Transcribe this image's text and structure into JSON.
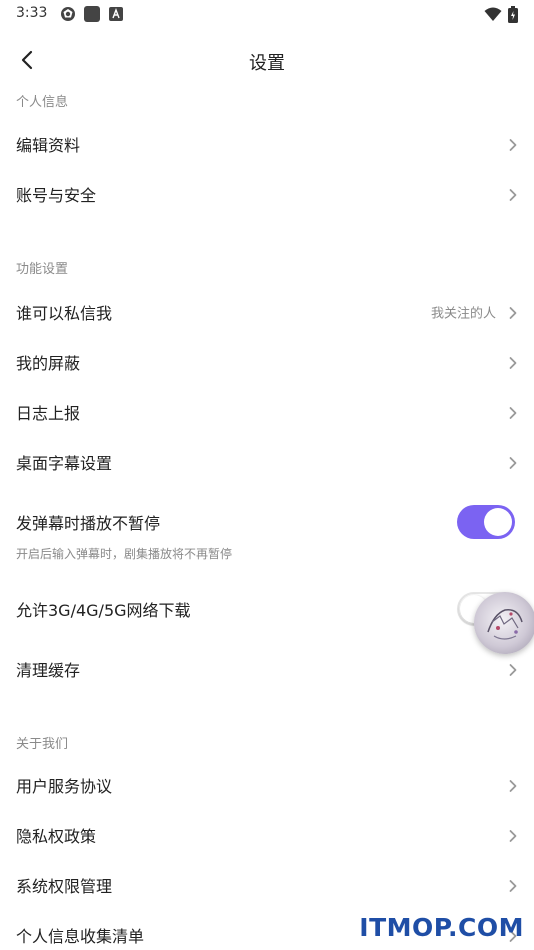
{
  "status_bar": {
    "time": "3:33",
    "icons": [
      "aperture-icon",
      "square-app-icon",
      "a-app-icon",
      "wifi-icon",
      "battery-icon"
    ]
  },
  "header": {
    "title": "设置",
    "back_icon": "chevron-left-icon"
  },
  "sections": {
    "personal": {
      "title": "个人信息",
      "items": [
        {
          "label": "编辑资料"
        },
        {
          "label": "账号与安全"
        }
      ]
    },
    "features": {
      "title": "功能设置",
      "items": [
        {
          "label": "谁可以私信我",
          "value": "我关注的人"
        },
        {
          "label": "我的屏蔽"
        },
        {
          "label": "日志上报"
        },
        {
          "label": "桌面字幕设置"
        }
      ],
      "danmaku_toggle": {
        "label": "发弹幕时播放不暂停",
        "description": "开启后输入弹幕时，剧集播放将不再暂停",
        "on": true
      },
      "network_toggle": {
        "label": "允许3G/4G/5G网络下载",
        "on": false
      },
      "clear_cache": {
        "label": "清理缓存"
      }
    },
    "about": {
      "title": "关于我们",
      "items": [
        {
          "label": "用户服务协议"
        },
        {
          "label": "隐私权政策"
        },
        {
          "label": "系统权限管理"
        },
        {
          "label": "个人信息收集清单"
        }
      ]
    }
  },
  "colors": {
    "accent": "#7b63f2",
    "secondary_text": "#8a8a8a",
    "watermark": "#1f4ea6"
  },
  "watermark": "ITMOP.COM"
}
